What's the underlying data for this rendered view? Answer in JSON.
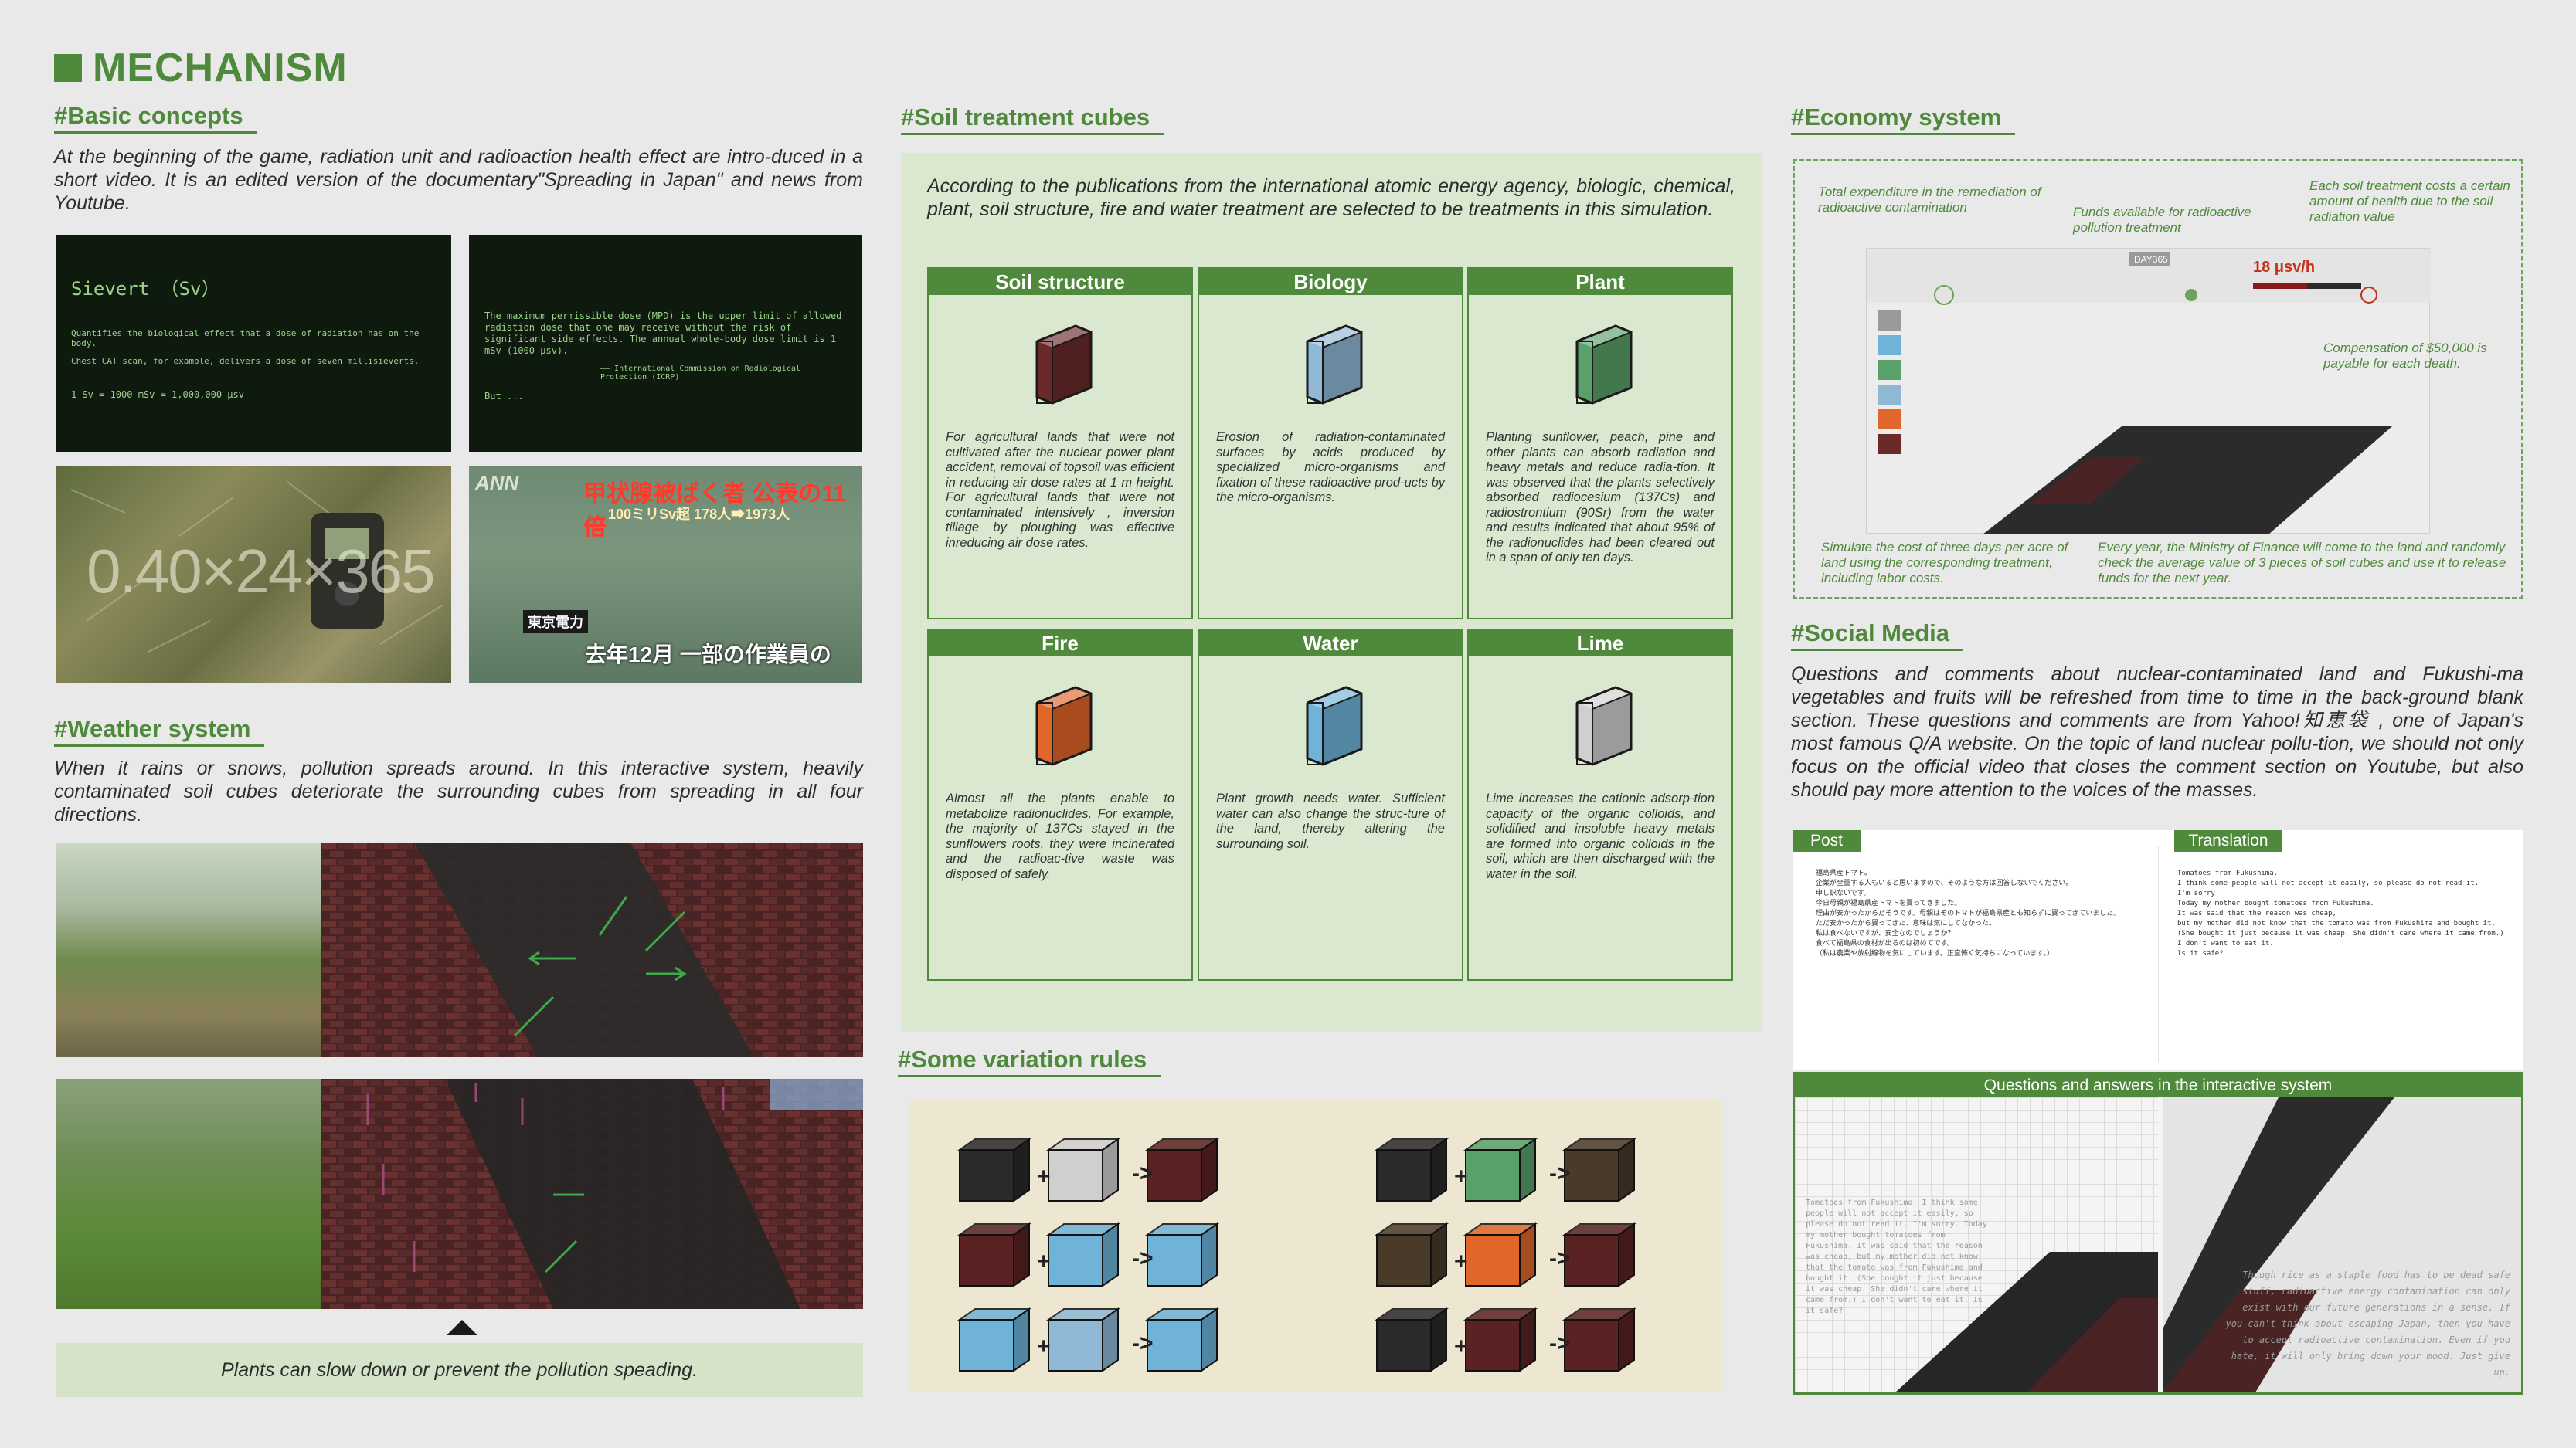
{
  "main_title": "MECHANISM",
  "basic": {
    "title": "#Basic concepts",
    "text": "At the beginning of the game, radiation unit and radioaction health effect are intro-duced in a short video. It is an edited version of the documentary\"Spreading in Japan\" and news from Youtube.",
    "panel1": {
      "heading": "Sievert （Sv）",
      "line1": "Quantifies the biological effect that a dose of radiation has on the body.",
      "line2": "Chest CAT scan, for example, delivers a dose of seven millisieverts.",
      "line3": "1 Sv = 1000 mSv = 1,000,000 μsv"
    },
    "panel2": {
      "text": "The maximum permissible dose (MPD) is the upper limit of allowed radiation dose that one may receive without the risk of significant side effects. The annual whole-body dose limit is 1 mSv (1000 μsv).",
      "source": "—— International Commission on Radiological Protection (ICRP)",
      "but": "But ..."
    },
    "photo1_overlay": "0.40×24×365",
    "news": {
      "logo": "ANN",
      "headline": "甲状腺被ばく者 公表の11倍",
      "subline": "100ミリSv超 178人➡1973人",
      "company": "東京電力",
      "caption": "去年12月 一部の作業員の"
    }
  },
  "weather": {
    "title": "#Weather system",
    "text": "When it rains or snows, pollution spreads around. In this interactive system, heavily contaminated soil cubes deteriorate the surrounding cubes from spreading in all four directions.",
    "caption": "Plants can slow down or prevent the pollution speading."
  },
  "soil": {
    "title": "#Soil treatment cubes",
    "intro": "According to the publications from the international atomic energy agency,  biologic, chemical, plant, soil structure, fire and water treatment are selected to be treatments in this simulation.",
    "cards": [
      {
        "name": "Soil structure",
        "text": "For agricultural lands that were not cultivated after the nuclear power plant accident, removal of topsoil was efficient in reducing air dose rates at 1 m height. For agricultural lands that were not contaminated intensively , inversion tillage by ploughing was effective inreducing air dose rates.",
        "color": "#6b2a2a"
      },
      {
        "name": "Biology",
        "text": "Erosion of radiation-contaminated surfaces by acids produced by specialized micro-organisms and fixation of these radioactive prod-ucts by the micro-organisms.",
        "color": "#8fb8d4"
      },
      {
        "name": "Plant",
        "text": "Planting sunflower, peach, pine and other plants can absorb radiation and heavy metals and reduce radia-tion. It was observed that the plants selectively absorbed radiocesium (137Cs) and radiostrontium (90Sr) from the water and results indicated that about 95% of the radionuclides had been cleared out in a span of only ten days.",
        "color": "#5aa06a"
      },
      {
        "name": "Fire",
        "text": "Almost all the plants enable to metabolize radionuclides. For example, the majority of 137Cs stayed in the sunflowers roots, they were incinerated and the radioac-tive waste was disposed of safely.",
        "color": "#e0662a"
      },
      {
        "name": "Water",
        "text": "Plant growth needs water. Sufficient water can also change the struc-ture of the land, thereby altering the surrounding soil.",
        "color": "#6fb3d8"
      },
      {
        "name": "Lime",
        "text": "Lime increases the cationic adsorp-tion capacity of the organic colloids, and solidified and insoluble heavy metals are formed into organic colloids in the soil, which are then discharged with the water in the soil.",
        "color": "#cfcfcf"
      }
    ]
  },
  "variation": {
    "title": "#Some variation rules",
    "plus": "+",
    "arrow": "->"
  },
  "economy": {
    "title": "#Economy system",
    "ann1": "Total expenditure in the remediation of radioactive contamination",
    "ann2": "Funds available for radioactive pollution treatment",
    "ann3": "Each soil treatment costs a certain amount of health due to the soil radiation value",
    "ann4": "Compensation of $50,000 is payable for each death.",
    "ann5": "Simulate the cost of three days per acre of land using the corresponding treatment, including labor costs.",
    "ann6": "Every year, the Ministry of Finance will come   to the land and randomly check the average value of  3 pieces of soil cubes and use it to release funds for the next year.",
    "game_day": "DAY365",
    "game_dose": "18 μsv/h"
  },
  "social": {
    "title": "#Social Media",
    "text": "Questions and comments about nuclear-contaminated land and Fukushi-ma vegetables and fruits will be refreshed from time to time in the back-ground blank section. These questions and comments are from Yahoo!知恵袋 , one of Japan's most famous Q/A website. On the topic of land nuclear pollu-tion, we should not only focus on the official video that closes the comment section on Youtube,  but also should pay more attention to the voices of the masses.",
    "post_label": "Post",
    "translation_label": "Translation",
    "post_text": "福島県産トマト。\n企業が全量する人もいると思いますので、そのような方は回答しないでください。\n申し訳ないです。\n今日母親が福島県産トマトを買ってきました。\n理由が安かったからだそうです。母親はそのトマトが福島県産とも知らずに買ってきていました。\nただ安かったから買ってきた、意味は気にしてなかった。\n私は食べないですが、安全なのでしょうか？\n食べて福島県の食材が出るのは初めてです。\n（私は農業や放射線物を気にしています。正直怖く気持ちになっています。）",
    "translation_text": "Tomatoes from Fukushima.\nI think some people will not accept it easily, so please do not read it.\nI'm sorry.\nToday my mother bought tomatoes from Fukushima.\nIt was said that the reason was cheap,\nbut my mother did not know that the tomato was from Fukushima and bought it.\n(She bought it just because it was cheap. She didn't care where it came from.)\nI don't want to eat it.\nIs it safe?",
    "qa_label": "Questions and answers in the interactive system",
    "qa_text_left": "Tomatoes from Fukushima. I think some people will not accept it easily, so please do not read it. I'm sorry. Today my mother bought tomatoes from Fukushima. It was said that the reason was cheap, but my mother did not know that the tomato was from Fukushima and bought it. (She bought it just because it was cheap. She didn't care where it came from.) I don't want to eat it. Is it safe?",
    "qa_text_right": "Though rice as a staple food has to be dead safe stuff, radioactive energy contamination can only exist with our future generations in a sense. If you can't think about escaping Japan, then you have to accept radioactive contamination. Even if you hate, it will only bring down your mood. Just give up."
  }
}
